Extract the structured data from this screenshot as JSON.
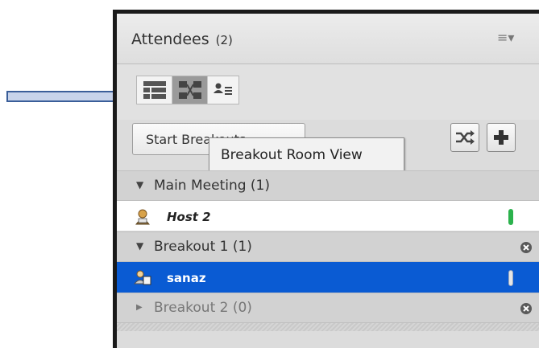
{
  "header": {
    "title": "Attendees",
    "count": "(2)",
    "menu_icon": "list-menu-icon"
  },
  "view_buttons": [
    {
      "icon": "list-view-icon",
      "active": false
    },
    {
      "icon": "breakout-view-icon",
      "active": true
    },
    {
      "icon": "presenter-view-icon",
      "active": false
    }
  ],
  "start_button": {
    "label": "Start Breakouts"
  },
  "tooltip": {
    "text": "Breakout Room View"
  },
  "tools": [
    {
      "icon": "shuffle-icon"
    },
    {
      "icon": "add-icon"
    }
  ],
  "rooms": {
    "main": {
      "label": "Main Meeting (1)"
    },
    "breakout1": {
      "label": "Breakout 1 (1)"
    },
    "breakout2": {
      "label": "Breakout 2 (0)"
    }
  },
  "attendees": {
    "host": {
      "name": "Host 2",
      "icon": "host-avatar-icon",
      "level_color": "#2bb24c"
    },
    "sanaz": {
      "name": "sanaz",
      "icon": "participant-avatar-icon",
      "level_color": "#e6e6e6"
    }
  },
  "colors": {
    "selection": "#0a5bd3",
    "arrow_fill": "#c7d3ea",
    "arrow_stroke": "#3a5e99"
  }
}
